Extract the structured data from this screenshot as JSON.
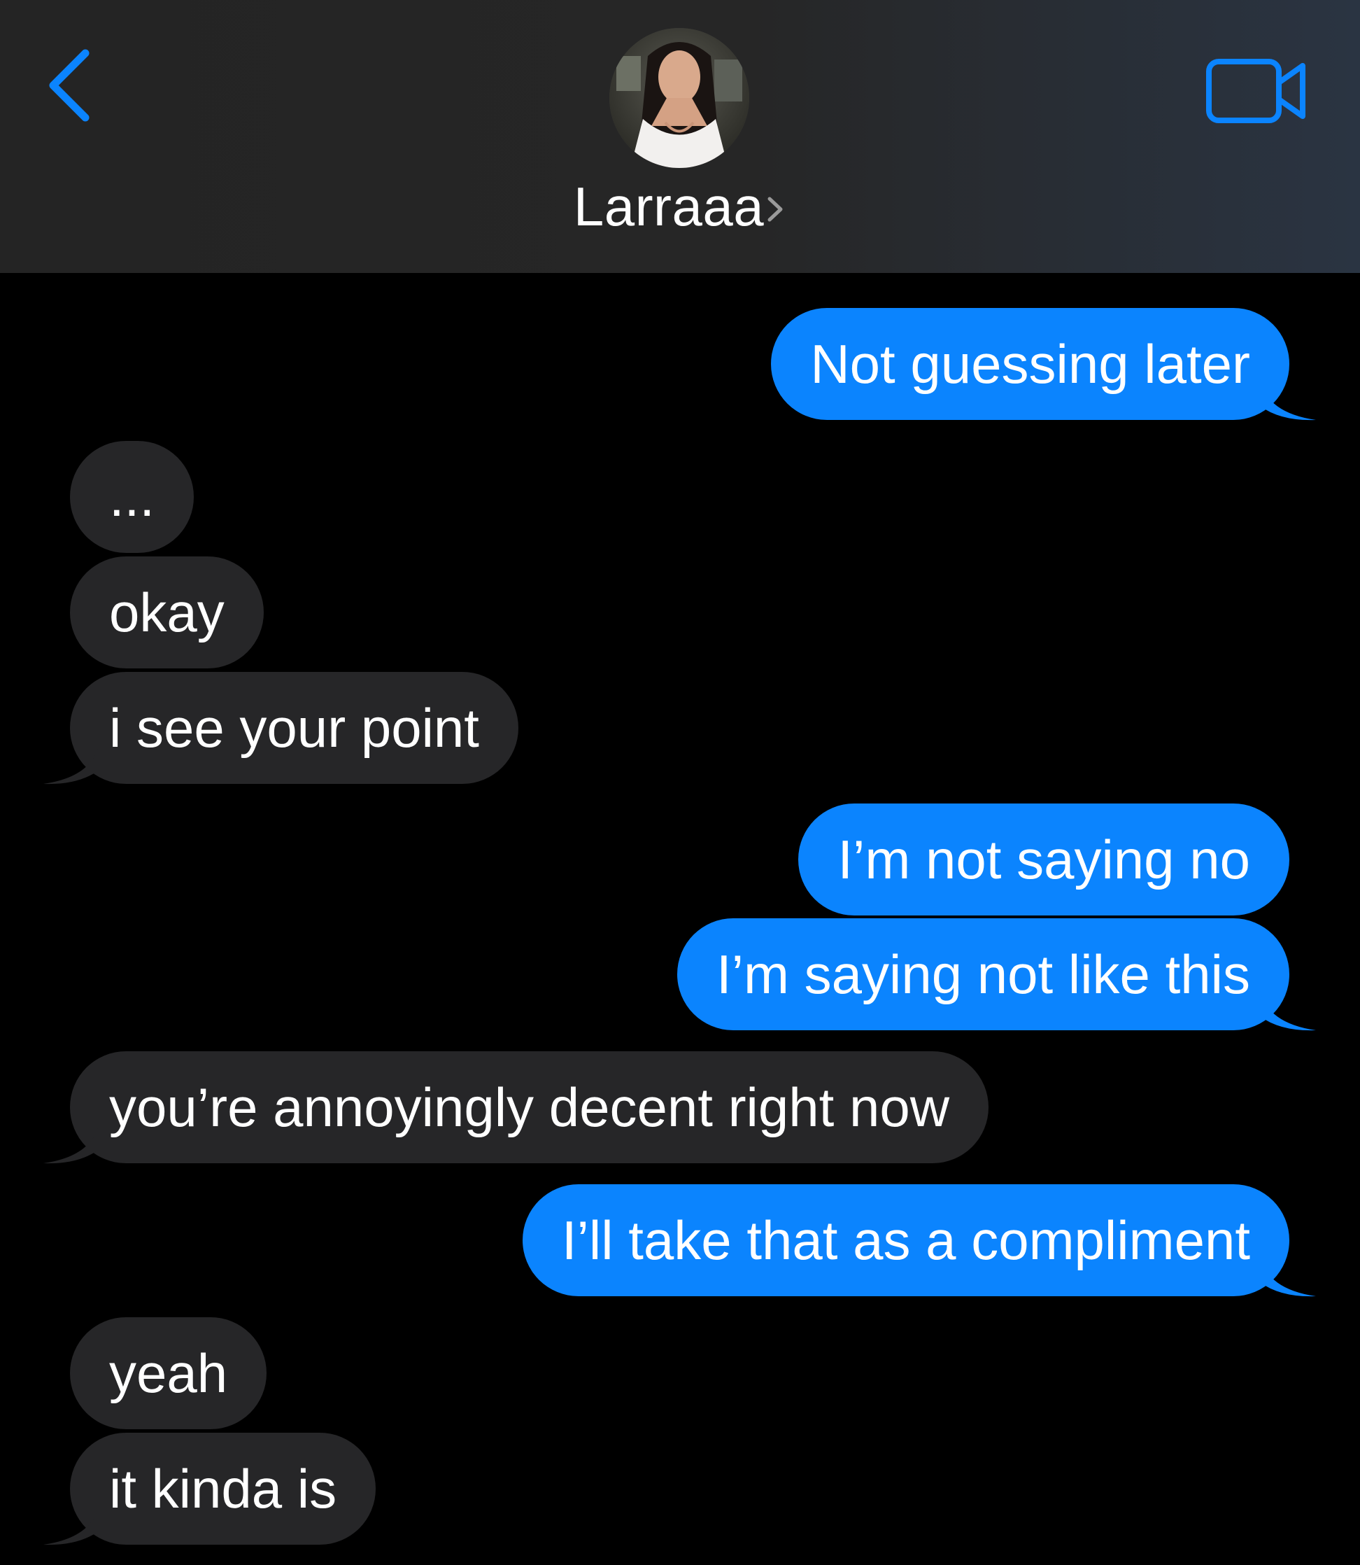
{
  "header": {
    "back_icon": "chevron-left-icon",
    "contact_name": "Larraaa",
    "contact_chevron_icon": "chevron-right-icon",
    "video_icon": "video-camera-icon",
    "accent_color": "#0b84fe"
  },
  "messages": [
    {
      "direction": "sent",
      "text": "Not guessing later",
      "tail": true
    },
    {
      "direction": "received",
      "text": "...",
      "tail": false
    },
    {
      "direction": "received",
      "text": "okay",
      "tail": false
    },
    {
      "direction": "received",
      "text": "i see your point",
      "tail": true
    },
    {
      "direction": "sent",
      "text": "I’m not saying no",
      "tail": false
    },
    {
      "direction": "sent",
      "text": "I’m saying not like this",
      "tail": true
    },
    {
      "direction": "received",
      "text": "you’re annoyingly decent right now",
      "tail": true
    },
    {
      "direction": "sent",
      "text": "I’ll take that as a compliment",
      "tail": true
    },
    {
      "direction": "received",
      "text": "yeah",
      "tail": false
    },
    {
      "direction": "received",
      "text": "it kinda is",
      "tail": true
    }
  ],
  "colors": {
    "sent_bubble": "#0b84fe",
    "received_bubble": "#262628",
    "background": "#000000",
    "header_background": "#252525"
  }
}
